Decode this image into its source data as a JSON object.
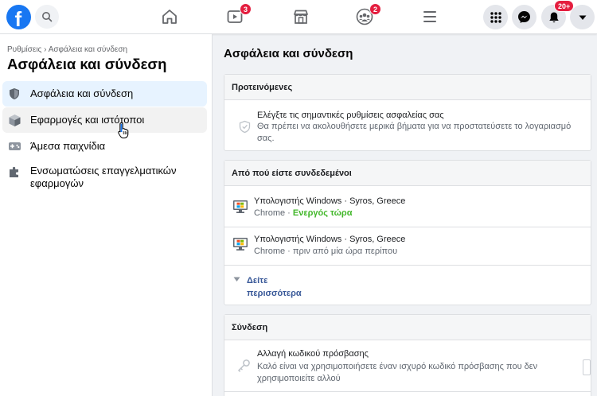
{
  "topbar": {
    "nav": [
      {
        "name": "home",
        "badge": ""
      },
      {
        "name": "watch",
        "badge": "3"
      },
      {
        "name": "marketplace",
        "badge": ""
      },
      {
        "name": "groups",
        "badge": "2"
      },
      {
        "name": "menu",
        "badge": ""
      }
    ],
    "right": {
      "notifications_badge": "20+"
    },
    "colors": {
      "brand": "#1877f2",
      "badge": "#e41e3f"
    }
  },
  "sidebar": {
    "breadcrumb": "Ρυθμίσεις › Ασφάλεια και σύνδεση",
    "title": "Ασφάλεια και σύνδεση",
    "items": [
      {
        "label": "Ασφάλεια και σύνδεση",
        "icon": "shield-icon"
      },
      {
        "label": "Εφαρμογές και ιστότοποι",
        "icon": "cube-icon"
      },
      {
        "label": "Άμεσα παιχνίδια",
        "icon": "gamepad-icon"
      },
      {
        "label": "Ενσωματώσεις επαγγελματικών εφαρμογών",
        "icon": "puzzle-icon"
      }
    ]
  },
  "main": {
    "title": "Ασφάλεια και σύνδεση",
    "recommended": {
      "header": "Προτεινόμενες",
      "title": "Ελέγξτε τις σημαντικές ρυθμίσεις ασφαλείας σας",
      "subtitle": "Θα πρέπει να ακολουθήσετε μερικά βήματα για να προστατεύσετε το λογαριασμό σας."
    },
    "where_logged_in": {
      "header": "Από πού είστε συνδεδεμένοι",
      "sessions": [
        {
          "device": "Υπολογιστής Windows · Syros, Greece",
          "browser": "Chrome",
          "sep": " · ",
          "status": "Ενεργός τώρα"
        },
        {
          "device": "Υπολογιστής Windows · Syros, Greece",
          "browser": "Chrome",
          "sep": " · ",
          "status": "πριν από μία ώρα περίπου"
        }
      ],
      "see_more": "Δείτε περισσότερα"
    },
    "login": {
      "header": "Σύνδεση",
      "title": "Αλλαγή κωδικού πρόσβασης",
      "subtitle": "Καλό είναι να χρησιμοποιήσετε έναν ισχυρό κωδικό πρόσβασης που δεν χρησιμοποιείτε αλλού"
    }
  }
}
